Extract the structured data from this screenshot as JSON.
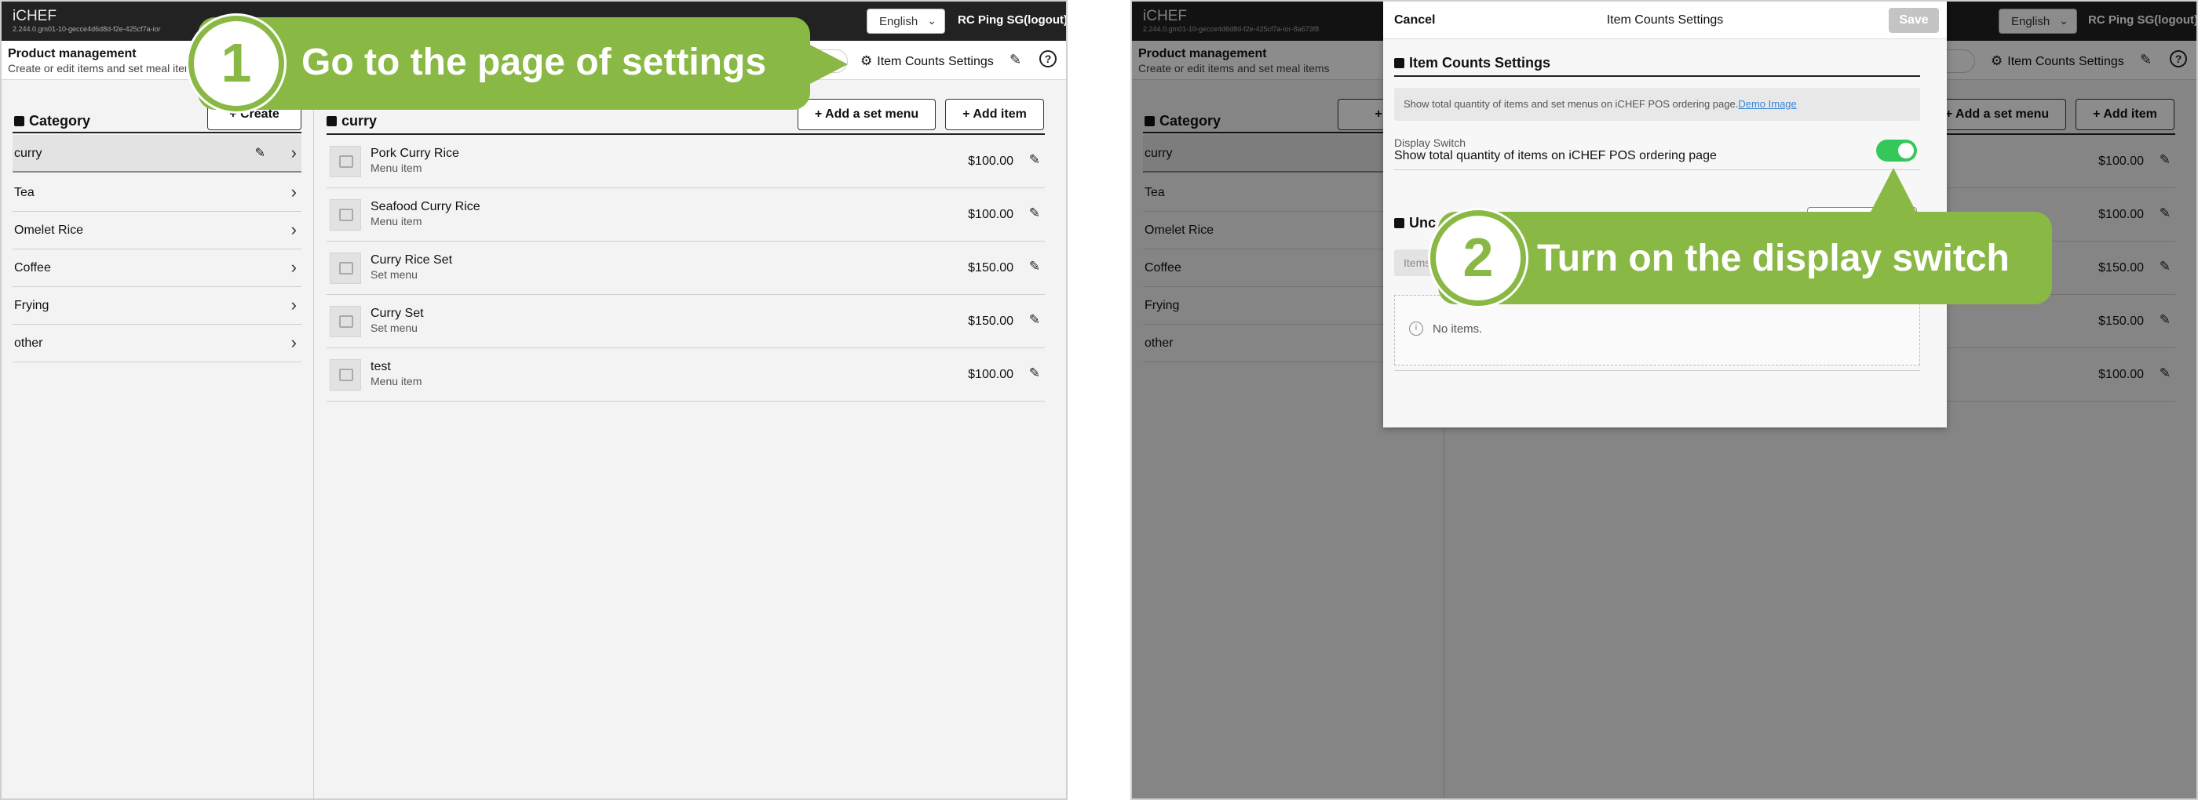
{
  "colors": {
    "callout": "#8ab845",
    "toggle_on": "#34c759",
    "topbar": "#222222",
    "link": "#3a86d8"
  },
  "left": {
    "app": {
      "name": "iCHEF",
      "version": "2.244.0.gm01-10-gecce4d6d8d-f2e-425cf7a-ior"
    },
    "language": "English",
    "user": "RC Ping SG(logout)",
    "page": {
      "title": "Product management",
      "subtitle": "Create or edit items and set meal items"
    },
    "settings_label": "Item Counts Settings",
    "category": {
      "title": "Category",
      "create_label": "Create",
      "items": [
        "curry",
        "Tea",
        "Omelet Rice",
        "Coffee",
        "Frying",
        "other"
      ]
    },
    "section": {
      "title": "curry",
      "add_set_menu_label": "Add a set menu",
      "add_item_label": "Add item"
    },
    "items": [
      {
        "name": "Pork Curry Rice",
        "type": "Menu item",
        "price": "$100.00"
      },
      {
        "name": "Seafood Curry Rice",
        "type": "Menu item",
        "price": "$100.00"
      },
      {
        "name": "Curry Rice Set",
        "type": "Set menu",
        "price": "$150.00"
      },
      {
        "name": "Curry Set",
        "type": "Set menu",
        "price": "$150.00"
      },
      {
        "name": "test",
        "type": "Menu item",
        "price": "$100.00"
      }
    ],
    "callout": {
      "number": "1",
      "text": "Go to the page of settings"
    }
  },
  "right": {
    "app": {
      "name": "iCHEF",
      "version": "2.244.0.gm01-10-gecce4d6d8d-f2e-425cf7a-ior-8a673f8"
    },
    "language": "English",
    "user": "RC Ping SG(logout)",
    "page": {
      "title": "Product management",
      "subtitle": "Create or edit items and set meal items"
    },
    "settings_label": "Item Counts Settings",
    "category": {
      "title": "Category",
      "create_partial": "C",
      "items": [
        "curry",
        "Tea",
        "Omelet Rice",
        "Coffee",
        "Frying",
        "other"
      ]
    },
    "section": {
      "add_set_menu_partial": "Add a set menu",
      "add_item_label": "Add item"
    },
    "prices": [
      "$100.00",
      "$100.00",
      "$150.00",
      "$150.00",
      "$100.00"
    ],
    "modal": {
      "cancel_label": "Cancel",
      "title": "Item Counts Settings",
      "save_label": "Save",
      "section_title": "Item Counts Settings",
      "info_text": "Show total quantity of items and set menus on iCHEF POS ordering page.",
      "info_link": "Demo Image",
      "display_switch_label": "Display Switch",
      "display_switch_desc": "Show total quantity of items on iCHEF POS ordering page",
      "display_switch_on": true,
      "uncategorized_partial": "Unc",
      "items_partial": "Items",
      "empty_text": "No items."
    },
    "callout": {
      "number": "2",
      "text": "Turn on the display switch"
    }
  }
}
